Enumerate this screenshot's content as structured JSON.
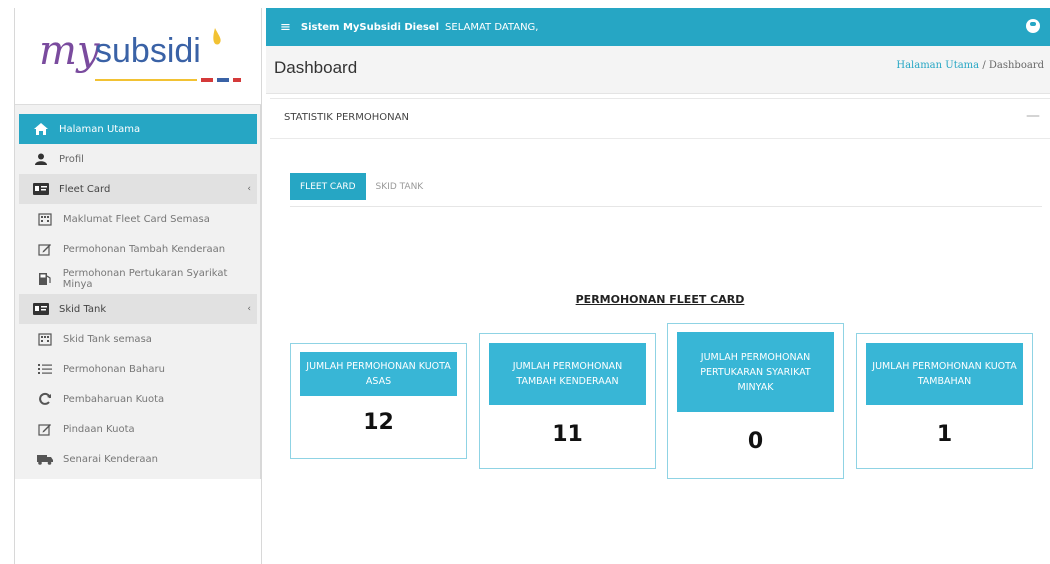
{
  "logo": {
    "text_my": "my",
    "text_subsidi": "subsidi"
  },
  "topbar": {
    "app_name": "Sistem MySubsidi Diesel",
    "greeting": "SELAMAT DATANG,"
  },
  "header": {
    "title": "Dashboard",
    "breadcrumb_home": "Halaman Utama",
    "breadcrumb_sep": "/",
    "breadcrumb_current": "Dashboard"
  },
  "sidebar": {
    "items": [
      {
        "label": "Halaman Utama",
        "icon": "home-icon"
      },
      {
        "label": "Profil",
        "icon": "user-icon"
      },
      {
        "label": "Fleet Card",
        "icon": "id-card-icon"
      },
      {
        "label": "Maklumat Fleet Card Semasa",
        "icon": "building-icon"
      },
      {
        "label": "Permohonan Tambah Kenderaan",
        "icon": "edit-icon"
      },
      {
        "label": "Permohonan Pertukaran Syarikat Minya",
        "icon": "fuel-icon"
      },
      {
        "label": "Skid Tank",
        "icon": "id-card-icon"
      },
      {
        "label": "Skid Tank semasa",
        "icon": "building-icon"
      },
      {
        "label": "Permohonan Baharu",
        "icon": "list-icon"
      },
      {
        "label": "Pembaharuan Kuota",
        "icon": "refresh-icon"
      },
      {
        "label": "Pindaan Kuota",
        "icon": "edit-icon"
      },
      {
        "label": "Senarai Kenderaan",
        "icon": "truck-icon"
      }
    ]
  },
  "stats": {
    "title": "STATISTIK PERMOHONAN",
    "tabs": [
      "FLEET CARD",
      "SKID TANK"
    ],
    "section_title": "PERMOHONAN FLEET CARD",
    "boxes": [
      {
        "label": "JUMLAH PERMOHONAN KUOTA ASAS",
        "value": "12"
      },
      {
        "label": "JUMLAH PERMOHONAN TAMBAH KENDERAAN",
        "value": "11"
      },
      {
        "label": "JUMLAH PERMOHONAN PERTUKARAN SYARIKAT MINYAK",
        "value": "0"
      },
      {
        "label": "JUMLAH PERMOHONAN KUOTA TAMBAHAN",
        "value": "1"
      }
    ]
  },
  "colors": {
    "primary": "#26a6c4",
    "label_bg": "#38b6d6",
    "box_border": "#8fd3e4",
    "sidebar_bg": "#f1f1f1"
  }
}
